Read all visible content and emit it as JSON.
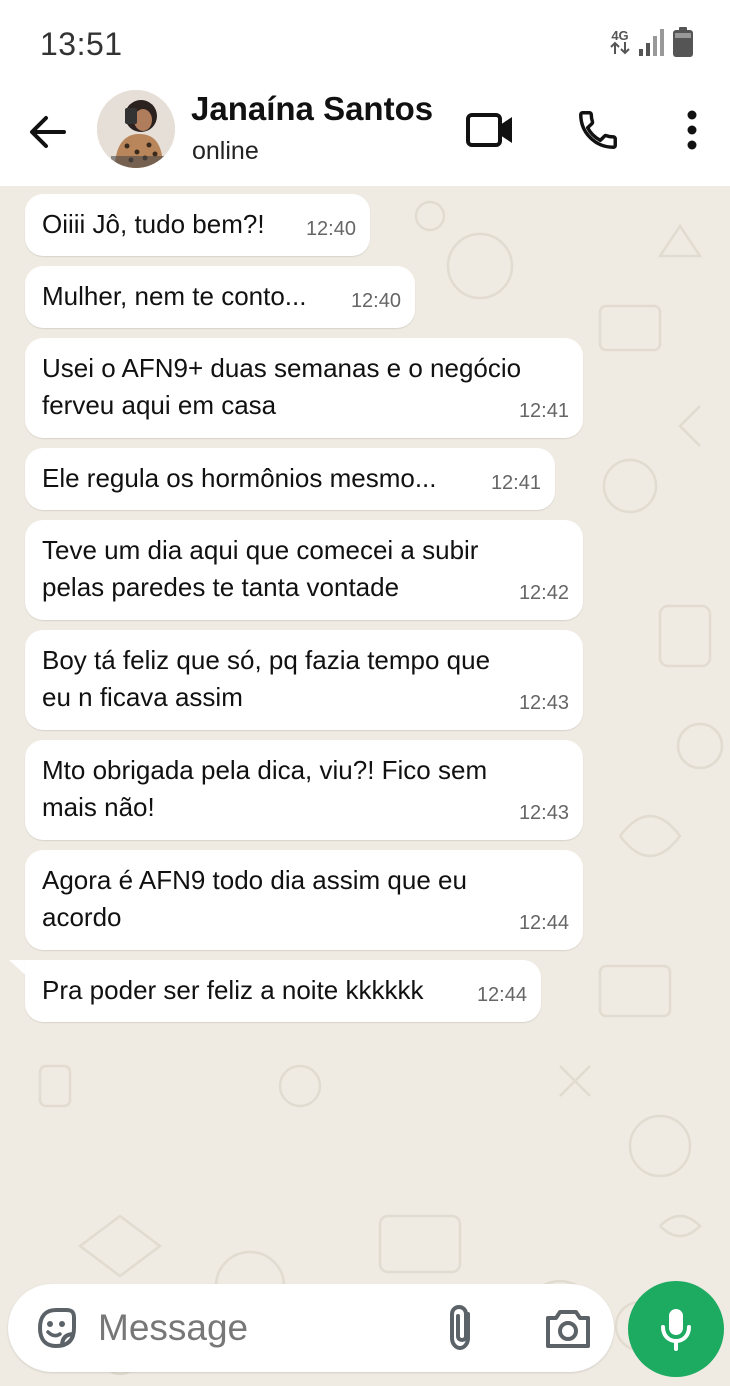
{
  "status_bar": {
    "time": "13:51",
    "network": "4G"
  },
  "header": {
    "contact_name": "Janaína Santos",
    "contact_status": "online"
  },
  "icons": {
    "back": "arrow-left-icon",
    "video": "video-call-icon",
    "call": "phone-icon",
    "menu": "more-vert-icon",
    "sticker": "sticker-icon",
    "attach": "paperclip-icon",
    "camera": "camera-icon",
    "mic": "microphone-icon"
  },
  "messages": [
    {
      "text": "Oiiii Jô, tudo bem?!",
      "time": "12:40"
    },
    {
      "text": "Mulher, nem te conto...",
      "time": "12:40"
    },
    {
      "text": "Usei o AFN9+ duas semanas e o negócio\nferveu aqui em casa",
      "time": "12:41"
    },
    {
      "text": "Ele regula os hormônios mesmo...",
      "time": "12:41"
    },
    {
      "text": "Teve um dia aqui que comecei a subir\npelas paredes te tanta vontade",
      "time": "12:42"
    },
    {
      "text": "Boy tá feliz que só, pq fazia tempo que\neu n ficava assim",
      "time": "12:43"
    },
    {
      "text": "Mto obrigada pela dica, viu?! Fico sem\nmais não!",
      "time": "12:43"
    },
    {
      "text": "Agora é AFN9 todo dia assim que eu\nacordo",
      "time": "12:44"
    },
    {
      "text": "Pra poder ser feliz a noite kkkkkk",
      "time": "12:44"
    }
  ],
  "composer": {
    "placeholder": "Message"
  },
  "colors": {
    "chat_bg": "#efeae2",
    "bubble_bg": "#ffffff",
    "mic_button": "#1daa61",
    "header_bg": "#ffffff"
  }
}
